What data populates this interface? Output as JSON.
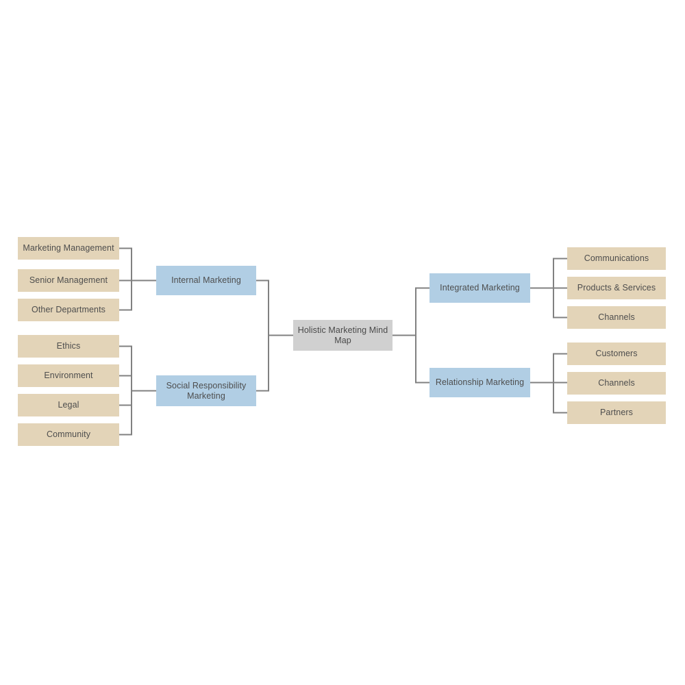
{
  "diagram": {
    "title": "Holistic Marketing Mind Map",
    "type": "mind-map",
    "colors": {
      "leaf": "#e3d4b8",
      "branch": "#b1cee4",
      "root": "#d0d0d0",
      "connector": "#808080",
      "text": "#4d4d4d",
      "background": "#ffffff"
    }
  },
  "root": {
    "label": "Holistic Marketing Mind Map"
  },
  "branches": {
    "internal_marketing": {
      "label": "Internal Marketing",
      "children": [
        {
          "label": "Marketing Management"
        },
        {
          "label": "Senior Management"
        },
        {
          "label": "Other Departments"
        }
      ]
    },
    "social_responsibility_marketing": {
      "label": "Social Responsibility Marketing",
      "children": [
        {
          "label": "Ethics"
        },
        {
          "label": "Environment"
        },
        {
          "label": "Legal"
        },
        {
          "label": "Community"
        }
      ]
    },
    "integrated_marketing": {
      "label": "Integrated Marketing",
      "children": [
        {
          "label": "Communications"
        },
        {
          "label": "Products & Services"
        },
        {
          "label": "Channels"
        }
      ]
    },
    "relationship_marketing": {
      "label": "Relationship Marketing",
      "children": [
        {
          "label": "Customers"
        },
        {
          "label": "Channels"
        },
        {
          "label": "Partners"
        }
      ]
    }
  }
}
